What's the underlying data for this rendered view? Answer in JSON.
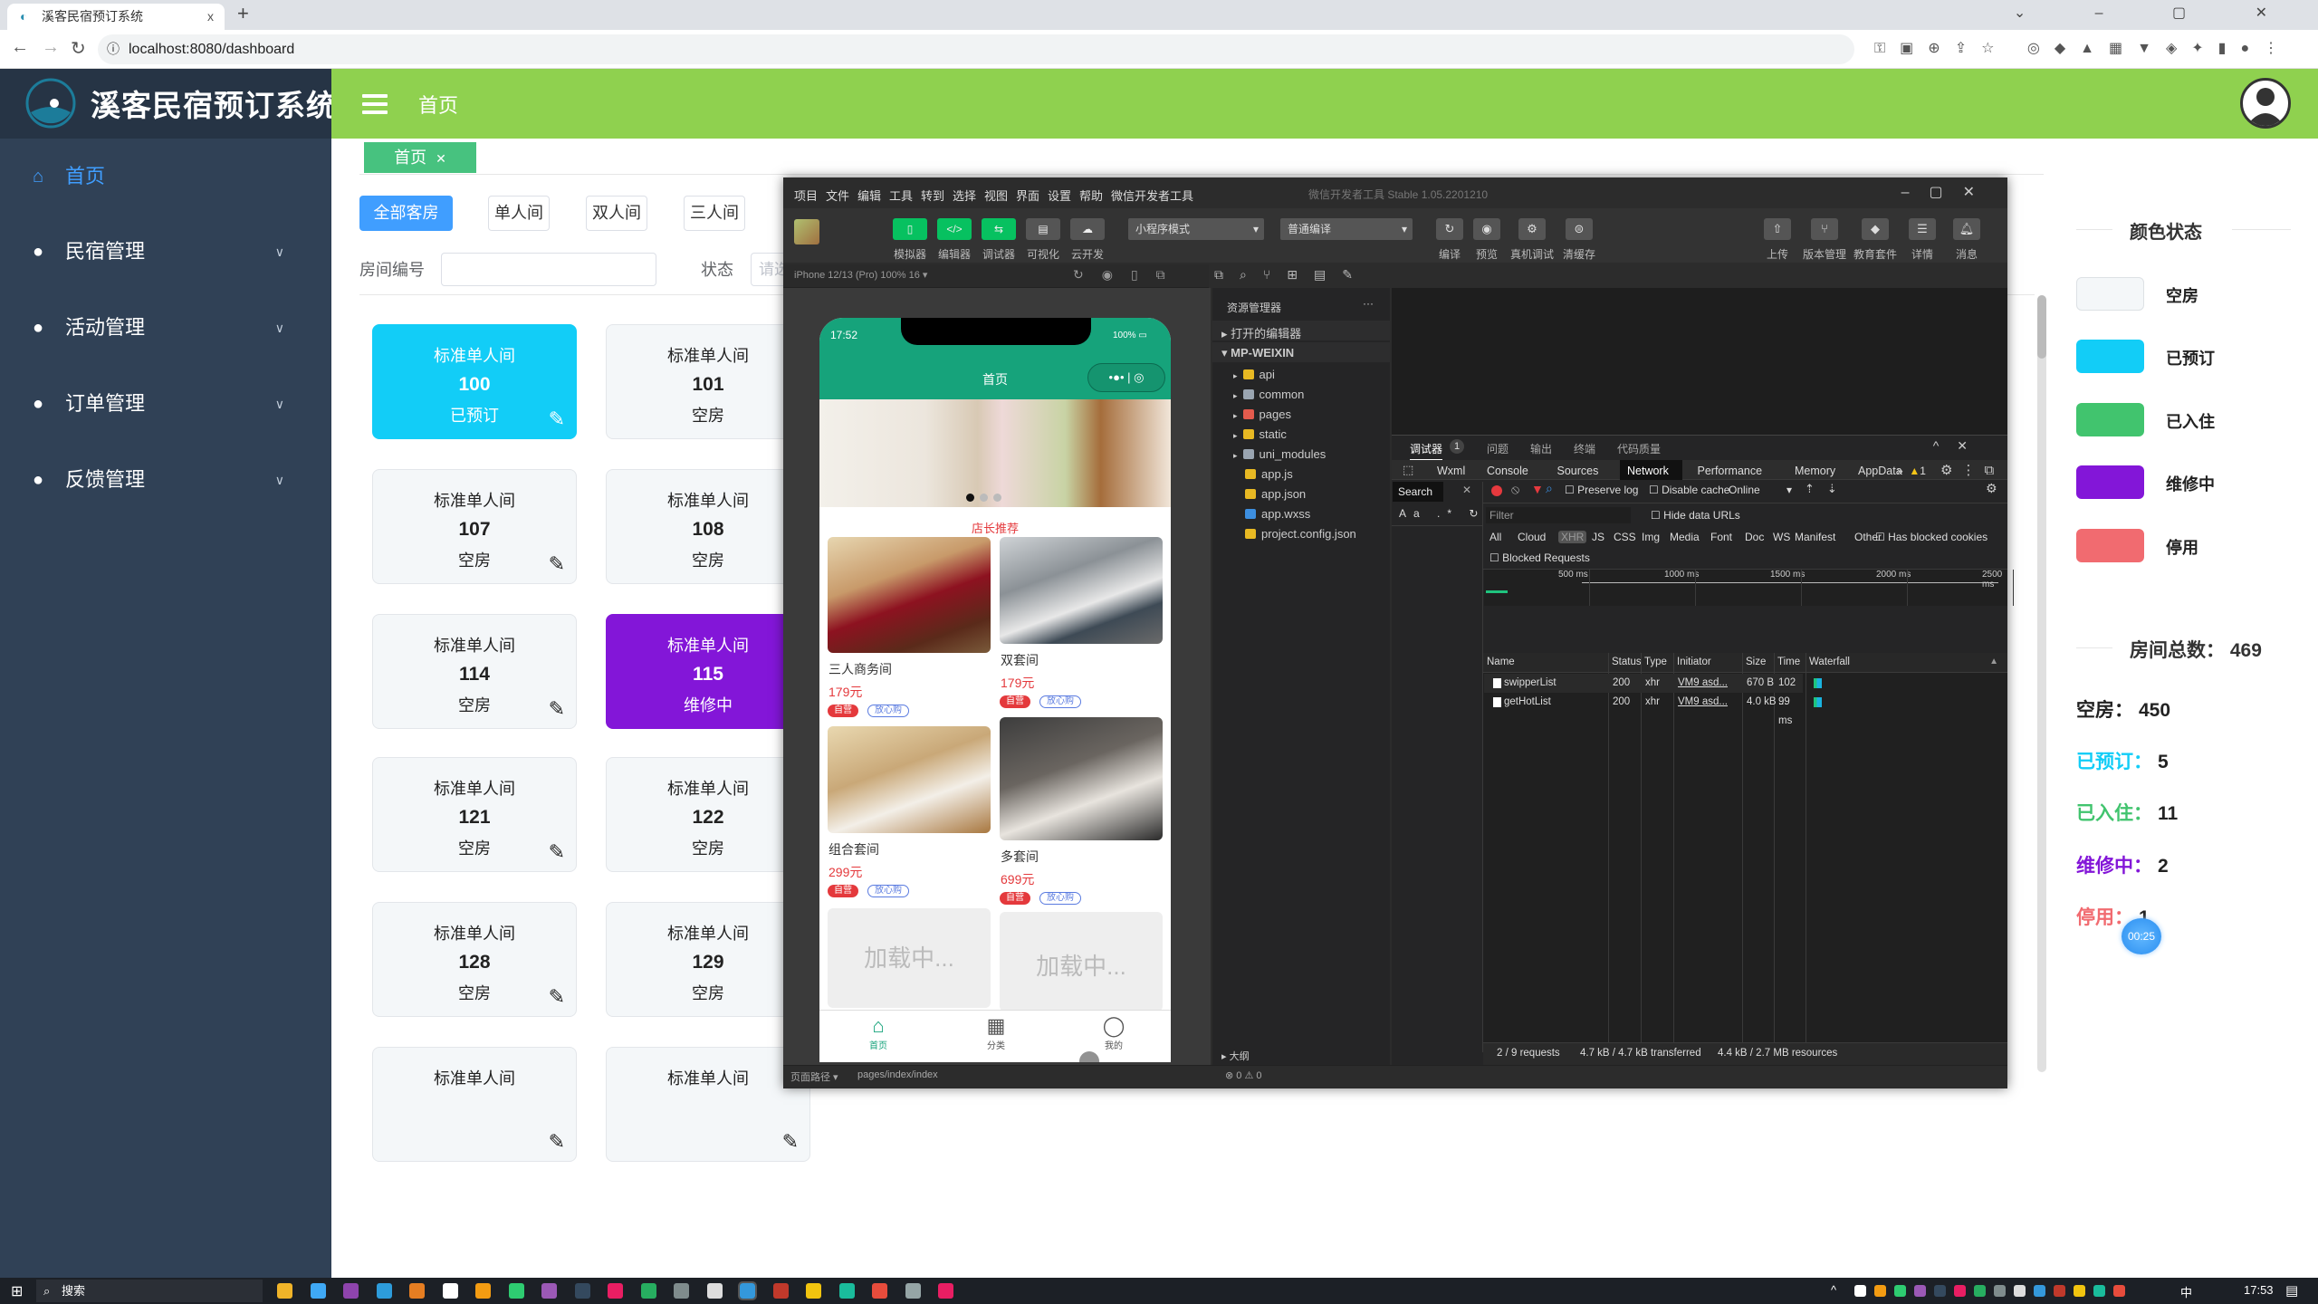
{
  "browser": {
    "tab_title": "溪客民宿预订系统",
    "url": "localhost:8080/dashboard",
    "new_tab": "+",
    "close_tab": "x"
  },
  "app": {
    "title": "溪客民宿预订系统",
    "header_title": "首页"
  },
  "sidebar": {
    "items": [
      {
        "label": "首页",
        "icon": "home-icon",
        "active": true
      },
      {
        "label": "民宿管理",
        "icon": "user-icon"
      },
      {
        "label": "活动管理",
        "icon": "user-icon"
      },
      {
        "label": "订单管理",
        "icon": "user-icon"
      },
      {
        "label": "反馈管理",
        "icon": "user-icon"
      }
    ]
  },
  "tags": [
    {
      "label": "首页",
      "close": "✕"
    }
  ],
  "filters": {
    "buttons": [
      "全部客房",
      "单人间",
      "双人间",
      "三人间"
    ],
    "active": 0,
    "room_no_label": "房间编号",
    "room_no_value": "",
    "status_label": "状态",
    "status_placeholder": "请选"
  },
  "rooms": [
    [
      {
        "type": "标准单人间",
        "no": "100",
        "status": "已预订",
        "color": "blue"
      },
      {
        "type": "标准单人间",
        "no": "101",
        "status": "空房"
      }
    ],
    [
      {
        "type": "标准单人间",
        "no": "107",
        "status": "空房"
      },
      {
        "type": "标准单人间",
        "no": "108",
        "status": "空房"
      }
    ],
    [
      {
        "type": "标准单人间",
        "no": "114",
        "status": "空房"
      },
      {
        "type": "标准单人间",
        "no": "115",
        "status": "维修中",
        "color": "purple"
      }
    ],
    [
      {
        "type": "标准单人间",
        "no": "121",
        "status": "空房"
      },
      {
        "type": "标准单人间",
        "no": "122",
        "status": "空房"
      }
    ],
    [
      {
        "type": "标准单人间",
        "no": "128",
        "status": "空房"
      },
      {
        "type": "标准单人间",
        "no": "129",
        "status": "空房"
      }
    ],
    [
      {
        "type": "标准单人间",
        "no": "",
        "status": ""
      },
      {
        "type": "标准单人间",
        "no": "",
        "status": ""
      }
    ]
  ],
  "legend": {
    "title": "颜色状态",
    "items": [
      {
        "label": "空房",
        "color": "#f4f7f9"
      },
      {
        "label": "已预订",
        "color": "#12cdf7"
      },
      {
        "label": "已入住",
        "color": "#41c46e"
      },
      {
        "label": "维修中",
        "color": "#8316d8"
      },
      {
        "label": "停用",
        "color": "#f16b70"
      }
    ]
  },
  "stats": {
    "total_label": "房间总数：",
    "total": "469",
    "items": [
      {
        "label": "空房：",
        "value": "450",
        "color": "#222222"
      },
      {
        "label": "已预订：",
        "value": "5",
        "color": "#12cdf7"
      },
      {
        "label": "已入住：",
        "value": "11",
        "color": "#41c46e"
      },
      {
        "label": "维修中：",
        "value": "2",
        "color": "#8316d8"
      },
      {
        "label": "停用：",
        "value": "1",
        "color": "#f16b70"
      }
    ]
  },
  "timer": "00:25",
  "devtools": {
    "menu": [
      "项目",
      "文件",
      "编辑",
      "工具",
      "转到",
      "选择",
      "视图",
      "界面",
      "设置",
      "帮助",
      "微信开发者工具"
    ],
    "title": "微信开发者工具 Stable 1.05.2201210",
    "tool_buttons": [
      "模拟器",
      "编辑器",
      "调试器",
      "可视化",
      "云开发"
    ],
    "mode": "小程序模式",
    "compile": "普通编译",
    "mid_buttons": [
      "编译",
      "预览",
      "真机调试",
      "清缓存"
    ],
    "right_buttons": [
      "上传",
      "版本管理",
      "教育套件",
      "详情",
      "消息"
    ],
    "device": "iPhone 12/13 (Pro) 100% 16 ▾",
    "explorer": {
      "title": "资源管理器",
      "more": "···",
      "open_editors": "打开的编辑器",
      "project": "MP-WEIXIN",
      "outline": "大纲",
      "tree": [
        {
          "name": "api",
          "kind": "folder",
          "color": "#e8b923"
        },
        {
          "name": "common",
          "kind": "folder",
          "color": "#9aa5b1"
        },
        {
          "name": "pages",
          "kind": "folder",
          "color": "#e55b4d"
        },
        {
          "name": "static",
          "kind": "folder",
          "color": "#e8b923"
        },
        {
          "name": "uni_modules",
          "kind": "folder",
          "color": "#9aa5b1"
        },
        {
          "name": "app.js",
          "kind": "file",
          "color": "#e8b923"
        },
        {
          "name": "app.json",
          "kind": "file",
          "color": "#e8b923"
        },
        {
          "name": "app.wxss",
          "kind": "file",
          "color": "#3d8fe0"
        },
        {
          "name": "project.config.json",
          "kind": "file",
          "color": "#e8b923"
        }
      ]
    },
    "panel_tabs": [
      "调试器",
      "问题",
      "输出",
      "终端",
      "代码质量"
    ],
    "panel_badge": "1",
    "dev_tabs": [
      "Wxml",
      "Console",
      "Sources",
      "Network",
      "Performance",
      "Memory",
      "AppData"
    ],
    "active_dev_tab": "Network",
    "warn_count": "1",
    "search_label": "Search",
    "preserve_log": "Preserve log",
    "disable_cache": "Disable cache",
    "throttle": "Online",
    "filter_placeholder": "Filter",
    "hide_data_urls": "Hide data URLs",
    "types": [
      "All",
      "Cloud",
      "XHR",
      "JS",
      "CSS",
      "Img",
      "Media",
      "Font",
      "Doc",
      "WS",
      "Manifest",
      "Other"
    ],
    "active_type": "XHR",
    "has_blocked": "Has blocked cookies",
    "blocked_requests": "Blocked Requests",
    "timeline": [
      "500 ms",
      "1000 ms",
      "1500 ms",
      "2000 ms",
      "2500 ms"
    ],
    "columns": [
      "Name",
      "Status",
      "Type",
      "Initiator",
      "Size",
      "Time",
      "Waterfall"
    ],
    "rows": [
      {
        "name": "swipperList",
        "status": "200",
        "type": "xhr",
        "initiator": "VM9 asd...",
        "size": "670 B",
        "time": "102 ..."
      },
      {
        "name": "getHotList",
        "status": "200",
        "type": "xhr",
        "initiator": "VM9 asd...",
        "size": "4.0 kB",
        "time": "99 ms"
      }
    ],
    "summary": [
      "2 / 9 requests",
      "4.7 kB / 4.7 kB transferred",
      "4.4 kB / 2.7 MB resources"
    ],
    "page_path_label": "页面路径 ▾",
    "page_path": "pages/index/index",
    "errors": "⊗ 0 ⚠ 0"
  },
  "phone": {
    "time": "17:52",
    "battery": "100%",
    "title": "首页",
    "section": "店长推荐",
    "products": [
      {
        "name": "三人商务间",
        "price": "179元"
      },
      {
        "name": "双套间",
        "price": "179元"
      },
      {
        "name": "组合套间",
        "price": "299元"
      },
      {
        "name": "多套间",
        "price": "699元"
      }
    ],
    "tag_self": "自营",
    "tag_safe": "放心购",
    "loading": "加载中...",
    "tabs": [
      "首页",
      "分类",
      "我的"
    ]
  },
  "taskbar": {
    "search": "搜索",
    "time": "17:53",
    "ime": "中"
  }
}
